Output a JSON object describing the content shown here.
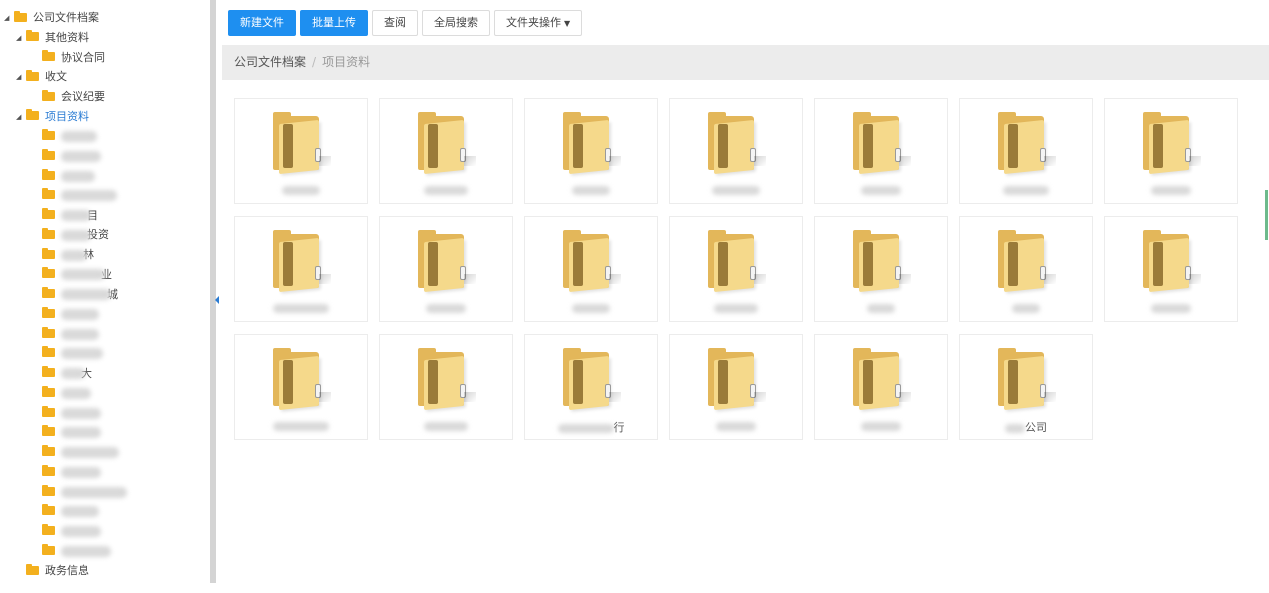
{
  "toolbar": {
    "buttons": [
      {
        "label": "新建文件",
        "primary": true
      },
      {
        "label": "批量上传",
        "primary": true
      },
      {
        "label": "查阅",
        "primary": false
      },
      {
        "label": "全局搜索",
        "primary": false
      },
      {
        "label": "文件夹操作",
        "primary": false,
        "dropdown": true
      }
    ]
  },
  "breadcrumb": {
    "root": "公司文件档案",
    "separator": "/",
    "current": "项目资料"
  },
  "tree": {
    "rows": [
      {
        "label": "公司文件档案",
        "indent": 0,
        "caret": true
      },
      {
        "label": "其他资料",
        "indent": 1,
        "caret": true
      },
      {
        "label": "协议合同",
        "indent": 2,
        "caret": false
      },
      {
        "label": "收文",
        "indent": 1,
        "caret": true
      },
      {
        "label": "会议纪要",
        "indent": 2,
        "caret": false
      },
      {
        "label": "项目资料",
        "indent": 1,
        "caret": true,
        "selected": true
      },
      {
        "label": "",
        "indent": 2,
        "blur": 36
      },
      {
        "label": "",
        "indent": 2,
        "blur": 40
      },
      {
        "label": "",
        "indent": 2,
        "blur": 34
      },
      {
        "label": "",
        "indent": 2,
        "blur": 56
      },
      {
        "label": "",
        "indent": 2,
        "blur": 30,
        "suffix": "目"
      },
      {
        "label": "",
        "indent": 2,
        "blur": 30,
        "suffix": "投资"
      },
      {
        "label": "",
        "indent": 2,
        "blur": 26,
        "suffix": "林"
      },
      {
        "label": "",
        "indent": 2,
        "blur": 44,
        "suffix": "业"
      },
      {
        "label": "",
        "indent": 2,
        "blur": 50,
        "suffix": "城"
      },
      {
        "label": "",
        "indent": 2,
        "blur": 38
      },
      {
        "label": "",
        "indent": 2,
        "blur": 38
      },
      {
        "label": "",
        "indent": 2,
        "blur": 42
      },
      {
        "label": "",
        "indent": 2,
        "blur": 24,
        "suffix": "大"
      },
      {
        "label": "",
        "indent": 2,
        "blur": 30
      },
      {
        "label": "",
        "indent": 2,
        "blur": 40
      },
      {
        "label": "",
        "indent": 2,
        "blur": 40
      },
      {
        "label": "",
        "indent": 2,
        "blur": 58
      },
      {
        "label": "",
        "indent": 2,
        "blur": 40
      },
      {
        "label": "",
        "indent": 2,
        "blur": 66
      },
      {
        "label": "",
        "indent": 2,
        "blur": 38
      },
      {
        "label": "",
        "indent": 2,
        "blur": 40
      },
      {
        "label": "",
        "indent": 2,
        "blur": 50
      },
      {
        "label": "政务信息",
        "indent": 1,
        "caret": false
      }
    ]
  },
  "folders": [
    {
      "label": "",
      "blur": 38
    },
    {
      "label": "",
      "blur": 44
    },
    {
      "label": "",
      "blur": 38
    },
    {
      "label": "",
      "blur": 48
    },
    {
      "label": "",
      "blur": 40
    },
    {
      "label": "",
      "blur": 46
    },
    {
      "label": "",
      "blur": 40
    },
    {
      "label": "",
      "blur": 56
    },
    {
      "label": "",
      "blur": 40
    },
    {
      "label": "",
      "blur": 38
    },
    {
      "label": "",
      "blur": 44
    },
    {
      "label": "",
      "blur": 28
    },
    {
      "label": "",
      "blur": 28
    },
    {
      "label": "",
      "blur": 40
    },
    {
      "label": "",
      "blur": 56
    },
    {
      "label": "",
      "blur": 44
    },
    {
      "label": "",
      "blur": 56,
      "suffix": "行"
    },
    {
      "label": "",
      "blur": 40
    },
    {
      "label": "",
      "blur": 40
    },
    {
      "label": "",
      "blur": 20,
      "suffix": "公司"
    }
  ],
  "colors": {
    "primary_button": "#1e8ff0",
    "selected_tree_text": "#2b7cd3",
    "folder_yellow": "#f3b01e",
    "breadcrumb_bg": "#ececec"
  }
}
